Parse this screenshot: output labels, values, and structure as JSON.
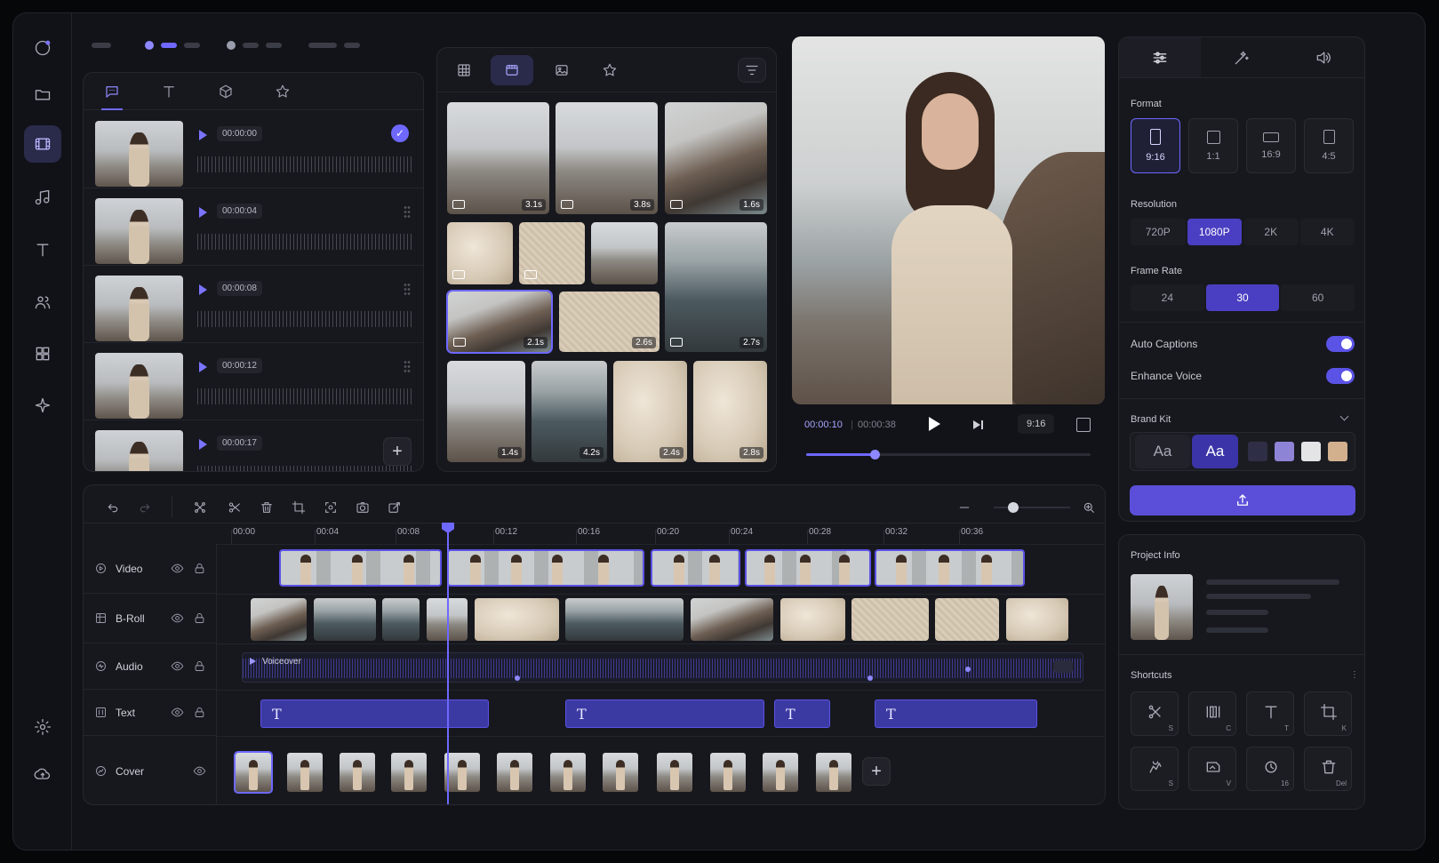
{
  "colors": {
    "accent": "#6e68ff",
    "accent_dark": "#4a3fc2"
  },
  "voice_rows": [
    {
      "time": "00:00:00",
      "selected": true
    },
    {
      "time": "00:00:04",
      "selected": false
    },
    {
      "time": "00:00:08",
      "selected": false
    },
    {
      "time": "00:00:12",
      "selected": false
    },
    {
      "time": "00:00:17",
      "selected": false
    }
  ],
  "media": {
    "durations": {
      "t1": "3.1s",
      "t2": "3.8s",
      "t3": "1.6s",
      "t4": "2.1s",
      "t5": "2.6s",
      "t6": "2.7s",
      "t7": "1.4s",
      "t8": "4.2s",
      "t9": "2.4s",
      "t10": "2.8s"
    }
  },
  "player": {
    "current": "00:00:10",
    "total": "00:00:38",
    "ratio": "9:16",
    "progress": 0.24
  },
  "settings": {
    "format_label": "Format",
    "formats": [
      "9:16",
      "1:1",
      "16:9",
      "4:5"
    ],
    "format_selected": "9:16",
    "resolution_label": "Resolution",
    "resolutions": [
      "720P",
      "1080P",
      "2K",
      "4K"
    ],
    "resolution_selected": "1080P",
    "framerate_label": "Frame Rate",
    "framerates": [
      "24",
      "30",
      "60"
    ],
    "framerate_selected": "30",
    "auto_captions": "Auto Captions",
    "enhance_voice": "Enhance Voice",
    "brand_kit": "Brand Kit",
    "font_a": "Aa",
    "font_b": "Aa",
    "swatches": [
      "#2e2f46",
      "#8d84d6",
      "#e4e4e6",
      "#d2b08e"
    ]
  },
  "project": {
    "title": "Project Info"
  },
  "shortcuts": {
    "title": "Shortcuts",
    "keys": [
      "S",
      "C",
      "T",
      "K",
      "S",
      "V",
      "16",
      "Del"
    ]
  },
  "timeline": {
    "ticks": [
      "00:00",
      "00:04",
      "00:08",
      "00:12",
      "00:16",
      "00:20",
      "00:24",
      "00:28",
      "00:32",
      "00:36"
    ],
    "tracks": [
      "Video",
      "B-Roll",
      "Audio",
      "Text",
      "Cover"
    ],
    "voiceover": "Voiceover",
    "text_glyph": "T",
    "zoom": 0.25
  }
}
